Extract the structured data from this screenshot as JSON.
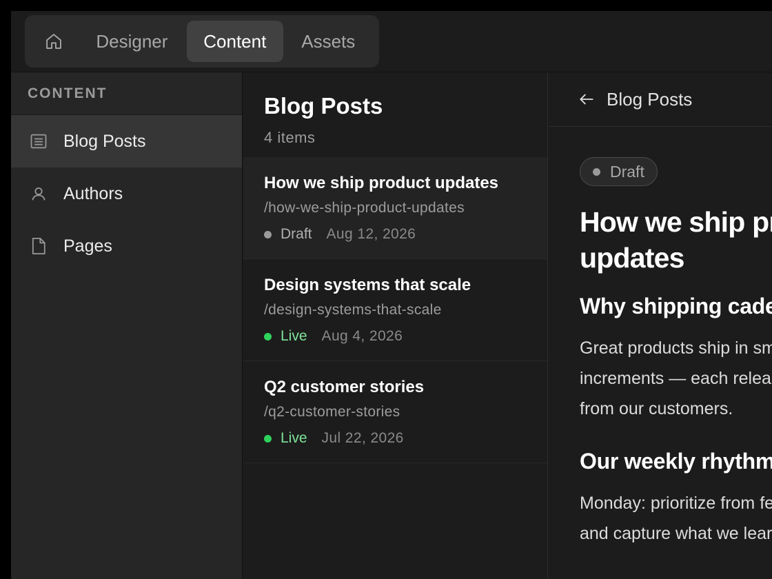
{
  "topbar": {
    "tabs": [
      {
        "label": "Designer"
      },
      {
        "label": "Content"
      },
      {
        "label": "Assets"
      }
    ],
    "active_tab": "Content"
  },
  "sidebar": {
    "header": "CONTENT",
    "items": [
      {
        "label": "Blog Posts",
        "icon": "list-icon",
        "active": true
      },
      {
        "label": "Authors",
        "icon": "user-icon"
      },
      {
        "label": "Pages",
        "icon": "page-icon"
      }
    ]
  },
  "list": {
    "title": "Blog Posts",
    "count": "4 items",
    "rows": [
      {
        "title": "How we ship product updates",
        "slug": "/how-we-ship-product-updates",
        "status": "Draft",
        "date": "Aug 12, 2026"
      },
      {
        "title": "Design systems that scale",
        "slug": "/design-systems-that-scale",
        "status": "Live",
        "date": "Aug 4, 2026"
      },
      {
        "title": "Q2 customer stories",
        "slug": "/q2-customer-stories",
        "status": "Live",
        "date": "Jul 22, 2026"
      }
    ]
  },
  "detail": {
    "back_label": "Blog Posts",
    "status": "Draft",
    "title": "How we ship product updates",
    "heading1": "Why shipping cadence matters",
    "paragraph1": "Great products ship in small, steady increments — each release a chance to learn from our customers.",
    "heading2": "Our weekly rhythm",
    "paragraph2": "Monday: prioritize from feedback. Friday: ship, and capture what we learned."
  },
  "colors": {
    "background": "#1c1c1c",
    "live": "#2fd35c",
    "draft": "#9a9a9a"
  }
}
